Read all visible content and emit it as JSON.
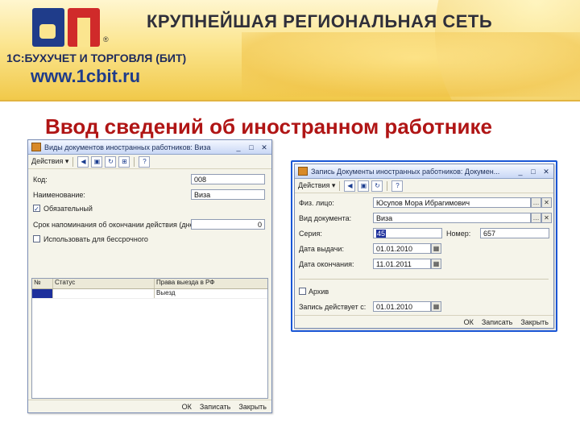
{
  "banner": {
    "tagline": "КРУПНЕЙШАЯ РЕГИОНАЛЬНАЯ СЕТЬ",
    "company": "1С:БУХУЧЕТ И ТОРГОВЛЯ (БИТ)",
    "website": "www.1cbit.ru",
    "logo_mark": "®"
  },
  "slide_title": "Ввод сведений об иностранном работнике",
  "window_left": {
    "title": "Виды документов иностранных работников: Виза",
    "toolbar_actions": "Действия ▾",
    "fields": {
      "code_label": "Код:",
      "code_value": "008",
      "name_label": "Наименование:",
      "name_value": "Виза",
      "mandatory_label": "Обязательный",
      "mandatory_checked": "✓",
      "reminder_label": "Срок напоминания об окончании действия (дней):",
      "reminder_value": "0",
      "unlimited_label": "Использовать для бессрочного"
    },
    "grid": {
      "headers": [
        "№",
        "Статус",
        "Права выезда в РФ"
      ],
      "rows": [
        [
          "",
          "",
          "Выезд"
        ]
      ]
    },
    "footer": {
      "ok": "ОК",
      "save": "Записать",
      "close": "Закрыть"
    }
  },
  "window_right": {
    "title": "Запись Документы иностранных работников: Докумен...",
    "toolbar_actions": "Действия ▾",
    "fields": {
      "person_label": "Физ. лицо:",
      "person_value": "Юсупов Мора Ибрагимович",
      "doctype_label": "Вид документа:",
      "doctype_value": "Виза",
      "series_label": "Серия:",
      "series_value": "45",
      "number_label": "Номер:",
      "number_value": "657",
      "issue_label": "Дата выдачи:",
      "issue_value": "01.01.2010",
      "expire_label": "Дата окончания:",
      "expire_value": "11.01.2011",
      "archive_label": "Архив",
      "valid_label": "Запись действует с:",
      "valid_value": "01.01.2010"
    },
    "footer": {
      "ok": "ОК",
      "save": "Записать",
      "close": "Закрыть"
    }
  }
}
